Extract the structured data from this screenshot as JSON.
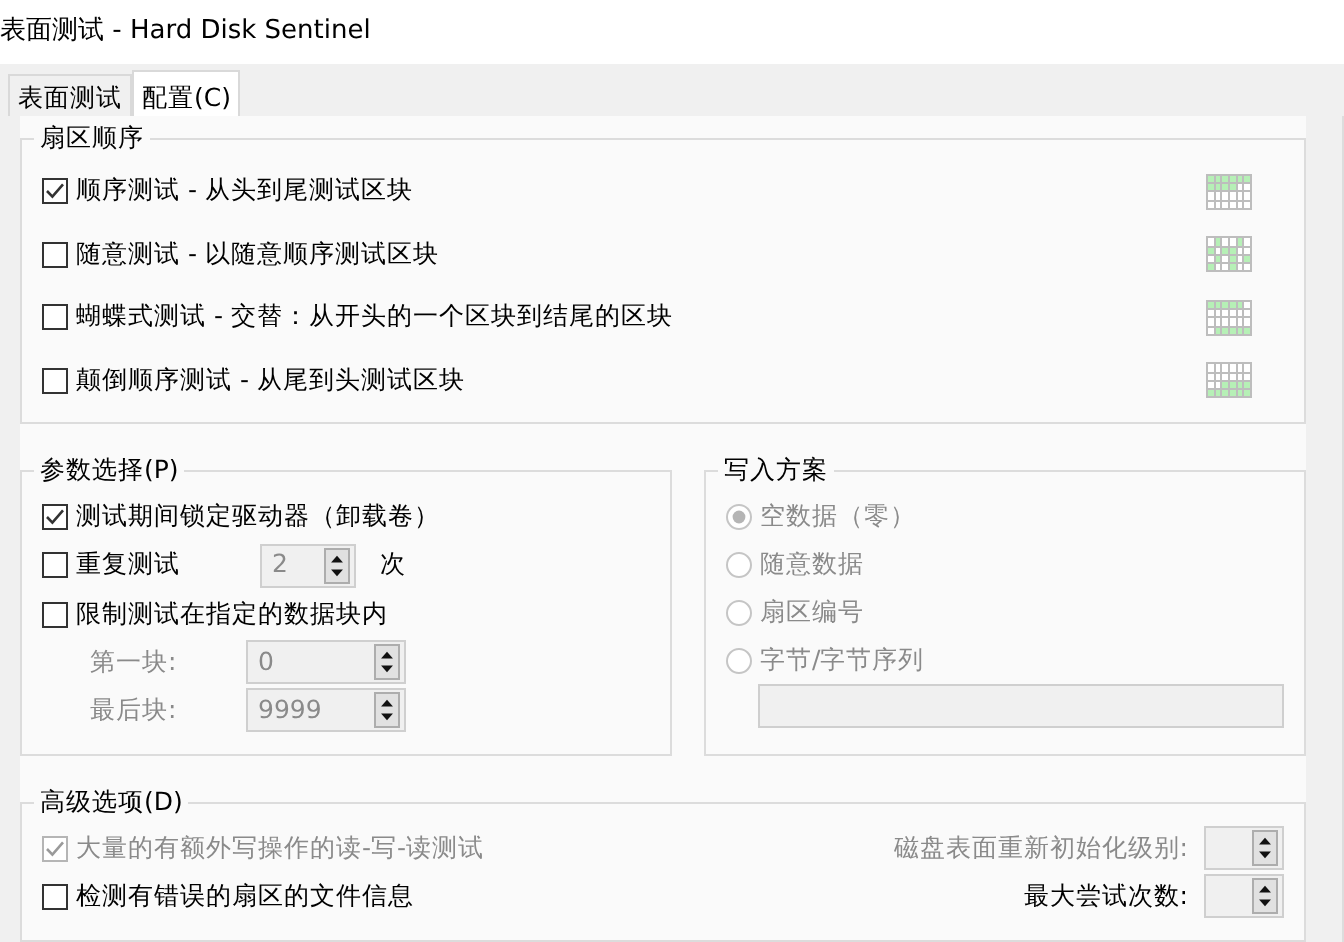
{
  "window": {
    "title": "表面测试 - Hard Disk Sentinel"
  },
  "tabs": [
    {
      "label": "表面测试",
      "selected": false
    },
    {
      "label": "配置(C)",
      "selected": true
    }
  ],
  "sector_order": {
    "title": "扇区顺序",
    "options": [
      {
        "label": "顺序测试 - 从头到尾测试区块",
        "checked": true,
        "kind": "sequential"
      },
      {
        "label": "随意测试 - 以随意顺序测试区块",
        "checked": false,
        "kind": "random"
      },
      {
        "label": "蝴蝶式测试 - 交替：从开头的一个区块到结尾的区块",
        "checked": false,
        "kind": "butterfly"
      },
      {
        "label": "颠倒顺序测试 - 从尾到头测试区块",
        "checked": false,
        "kind": "reverse"
      }
    ]
  },
  "parameters": {
    "title": "参数选择(P)",
    "lock": {
      "label": "测试期间锁定驱动器（卸载卷）",
      "checked": true
    },
    "repeat": {
      "label": "重复测试",
      "checked": false,
      "value": "2",
      "unit": "次",
      "disabled": true
    },
    "limit": {
      "label": "限制测试在指定的数据块内",
      "checked": false
    },
    "range": [
      {
        "label": "第一块:",
        "value": "0",
        "disabled": true
      },
      {
        "label": "最后块:",
        "value": "9999",
        "disabled": true
      }
    ]
  },
  "write_scheme": {
    "title": "写入方案",
    "options": [
      {
        "label": "空数据（零）",
        "selected": true,
        "disabled": true
      },
      {
        "label": "随意数据",
        "selected": false,
        "disabled": true
      },
      {
        "label": "扇区编号",
        "selected": false,
        "disabled": true
      },
      {
        "label": "字节/字节序列",
        "selected": false,
        "disabled": true
      }
    ],
    "pattern_field": {
      "disabled": true
    }
  },
  "advanced": {
    "title": "高级选项(D)",
    "options": [
      {
        "label": "大量的有额外写操作的读-写-读测试",
        "checked": true,
        "disabled": true
      },
      {
        "label": "检测有错误的扇区的文件信息",
        "checked": false,
        "disabled": false
      }
    ],
    "settings": [
      {
        "label": "磁盘表面重新初始化级别:"
      },
      {
        "label": "最大尝试次数:"
      }
    ]
  }
}
